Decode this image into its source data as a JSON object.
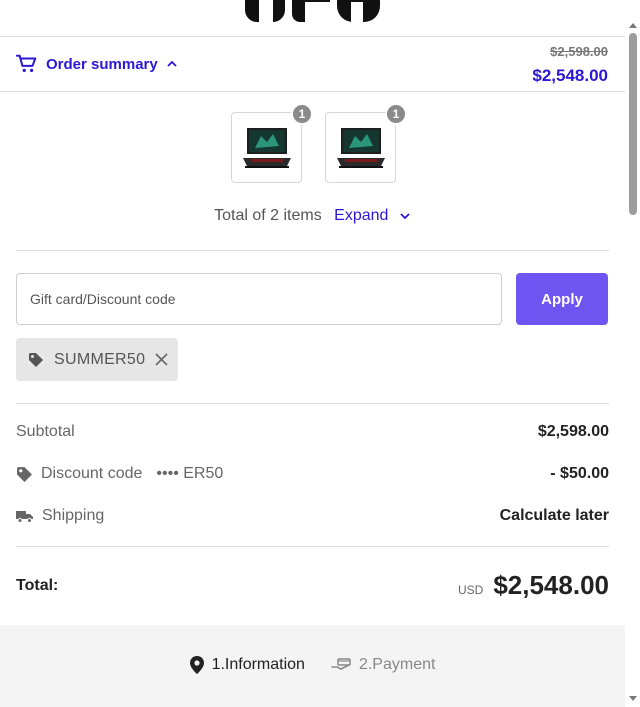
{
  "brand": {
    "logo_text": "GPD",
    "logo_icon": "gpd-logo"
  },
  "summary": {
    "toggle_label": "Order summary",
    "cart_icon": "cart-icon",
    "chevron_icon": "chevron-up-icon",
    "original_price": "$2,598.00",
    "final_price": "$2,548.00"
  },
  "items": [
    {
      "quantity": "1",
      "image_icon": "laptop-image"
    },
    {
      "quantity": "1",
      "image_icon": "laptop-image"
    }
  ],
  "items_footer": {
    "total_label": "Total of 2 items",
    "expand_label": "Expand",
    "expand_icon": "chevron-down-icon"
  },
  "discount": {
    "placeholder": "Gift card/Discount code",
    "apply_label": "Apply",
    "applied_code": "SUMMER50",
    "tag_icon": "tag-icon",
    "remove_icon": "close-icon"
  },
  "totals": {
    "subtotal_label": "Subtotal",
    "subtotal_value": "$2,598.00",
    "discount_label": "Discount code",
    "discount_masked": "•••• ER50",
    "discount_value": "- $50.00",
    "shipping_label": "Shipping",
    "shipping_value": "Calculate later",
    "total_label": "Total:",
    "currency": "USD",
    "total_value": "$2,548.00"
  },
  "steps": [
    {
      "label": "1.Information",
      "icon": "location-pin-icon",
      "active": true
    },
    {
      "label": "2.Payment",
      "icon": "payment-hand-icon",
      "active": false
    }
  ],
  "colors": {
    "accent": "#2b18d6",
    "button": "#6e55f2",
    "chip_bg": "#e6e6e6",
    "footer_bg": "#f4f4f4"
  }
}
